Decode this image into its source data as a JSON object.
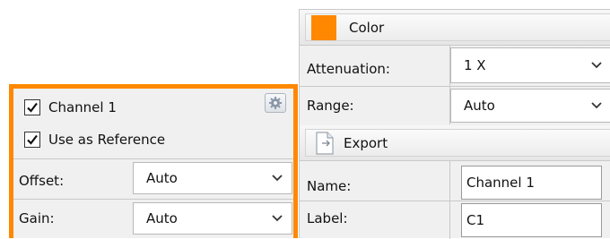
{
  "channel_panel": {
    "channel_checkbox": {
      "label": "Channel 1",
      "checked": true
    },
    "reference_checkbox": {
      "label": "Use as Reference",
      "checked": true
    },
    "settings_icon": "gear-icon",
    "offset": {
      "label": "Offset:",
      "value": "Auto"
    },
    "gain": {
      "label": "Gain:",
      "value": "Auto"
    },
    "accent_color": "#ff8800"
  },
  "properties_panel": {
    "color_section": {
      "title": "Color",
      "swatch_color": "#ff8800"
    },
    "attenuation": {
      "label": "Attenuation:",
      "value": "1 X"
    },
    "range": {
      "label": "Range:",
      "value": "Auto"
    },
    "export_section": {
      "title": "Export",
      "icon": "export-page-icon"
    },
    "name": {
      "label": "Name:",
      "value": "Channel 1"
    },
    "label_field": {
      "label": "Label:",
      "value": "C1"
    }
  }
}
